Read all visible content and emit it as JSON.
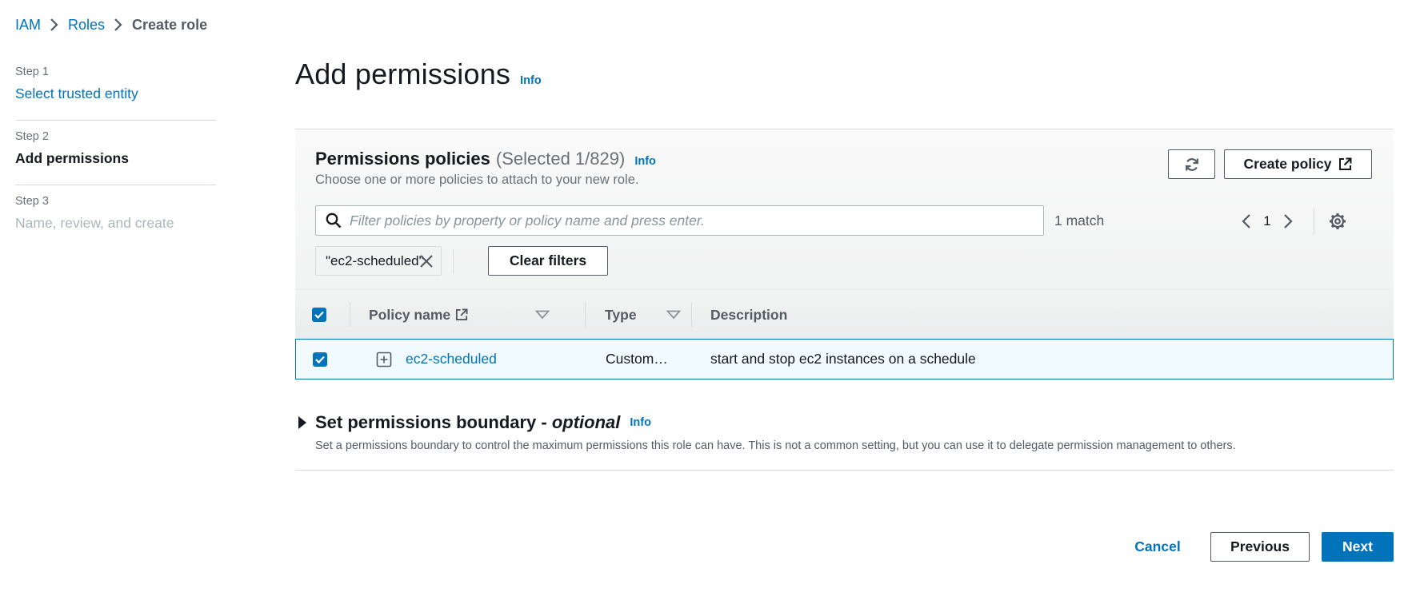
{
  "breadcrumb": {
    "items": [
      "IAM",
      "Roles",
      "Create role"
    ]
  },
  "steps": [
    {
      "num": "Step 1",
      "title": "Select trusted entity"
    },
    {
      "num": "Step 2",
      "title": "Add permissions"
    },
    {
      "num": "Step 3",
      "title": "Name, review, and create"
    }
  ],
  "header": {
    "title": "Add permissions",
    "info": "Info"
  },
  "policies": {
    "title": "Permissions policies",
    "count": "(Selected 1/829)",
    "info": "Info",
    "description": "Choose one or more policies to attach to your new role.",
    "refresh_icon": "refresh-icon",
    "create_label": "Create policy",
    "search_placeholder": "Filter policies by property or policy name and press enter.",
    "match_count": "1 match",
    "page": "1",
    "filter_token": "\"ec2-scheduled\"",
    "clear_label": "Clear filters",
    "columns": [
      "Policy name",
      "Type",
      "Description"
    ],
    "rows": [
      {
        "name": "ec2-scheduled",
        "type": "Custom…",
        "description": "start and stop ec2 instances on a schedule",
        "selected": true
      }
    ]
  },
  "boundary": {
    "title": "Set permissions boundary - ",
    "title_optional": "optional",
    "info": "Info",
    "description": "Set a permissions boundary to control the maximum permissions this role can have. This is not a common setting, but you can use it to delegate permission management to others."
  },
  "footer": {
    "cancel": "Cancel",
    "previous": "Previous",
    "next": "Next"
  },
  "colors": {
    "link": "#0073bb",
    "primary": "#0073bb",
    "text": "#16191f",
    "muted": "#687078",
    "selected_row": "#f1faff"
  }
}
